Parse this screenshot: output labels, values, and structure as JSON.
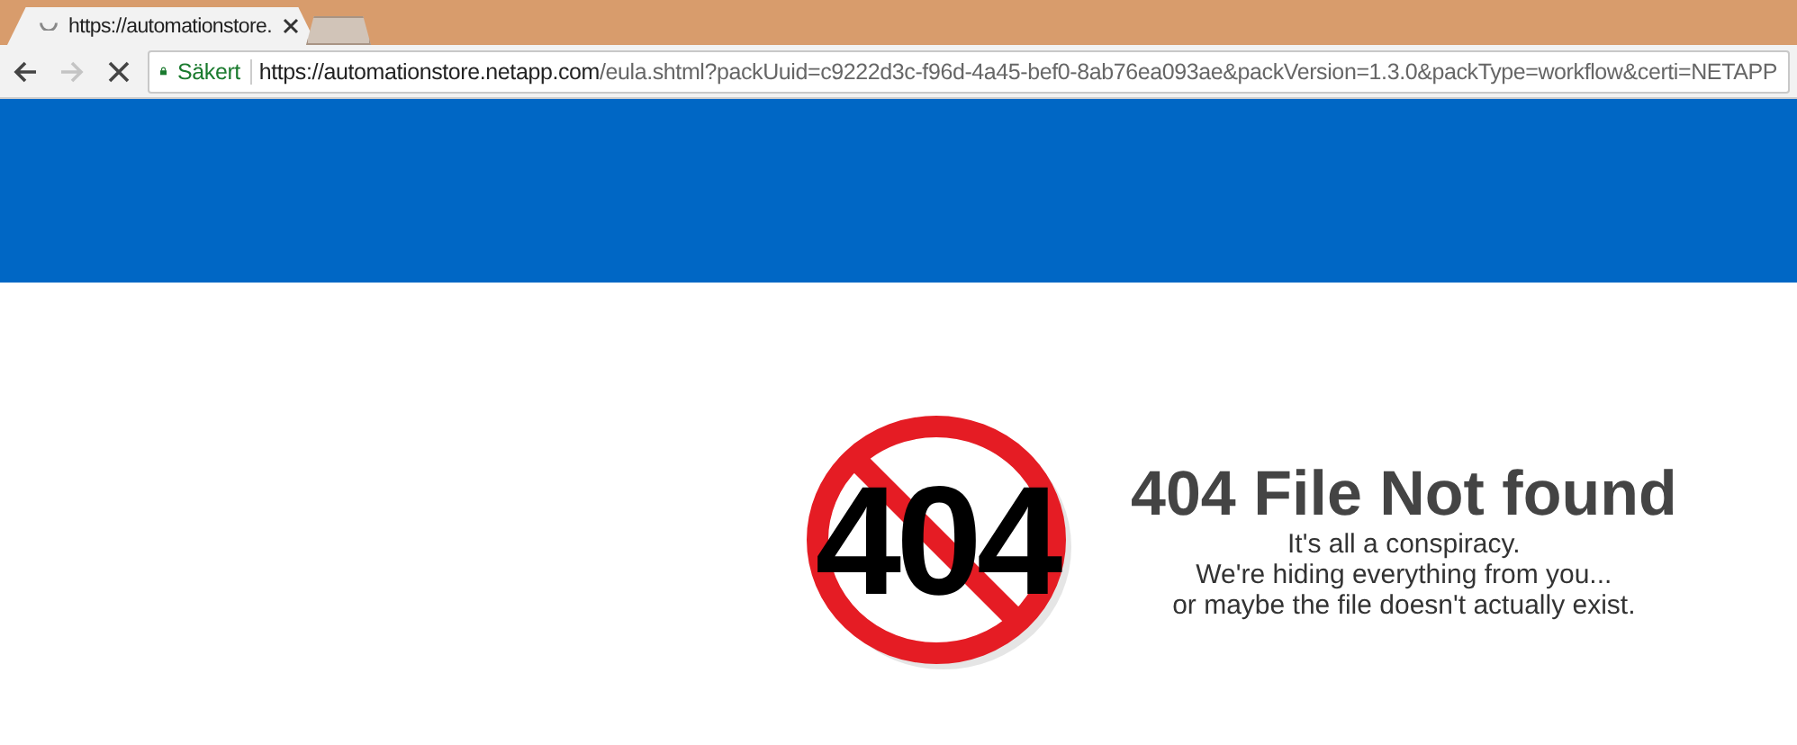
{
  "tabs": [
    {
      "title": "https://automationstore.",
      "loading": true,
      "selected": true
    },
    {
      "selected": false
    }
  ],
  "toolbar": {
    "forward_disabled": true,
    "loading": true
  },
  "address_bar": {
    "security_label": "Säkert",
    "url_host": "https://automationstore.netapp.com",
    "url_path": "/eula.shtml?packUuid=c9222d3c-f96d-4a45-bef0-8ab76ea093ae&packVersion=1.3.0&packType=workflow&certi=NETAPP"
  },
  "error": {
    "sign_text": "404",
    "heading": "404 File Not found",
    "lines": [
      "It's all a conspiracy.",
      "We're hiding everything from you...",
      "or maybe the file doesn't actually exist."
    ]
  }
}
